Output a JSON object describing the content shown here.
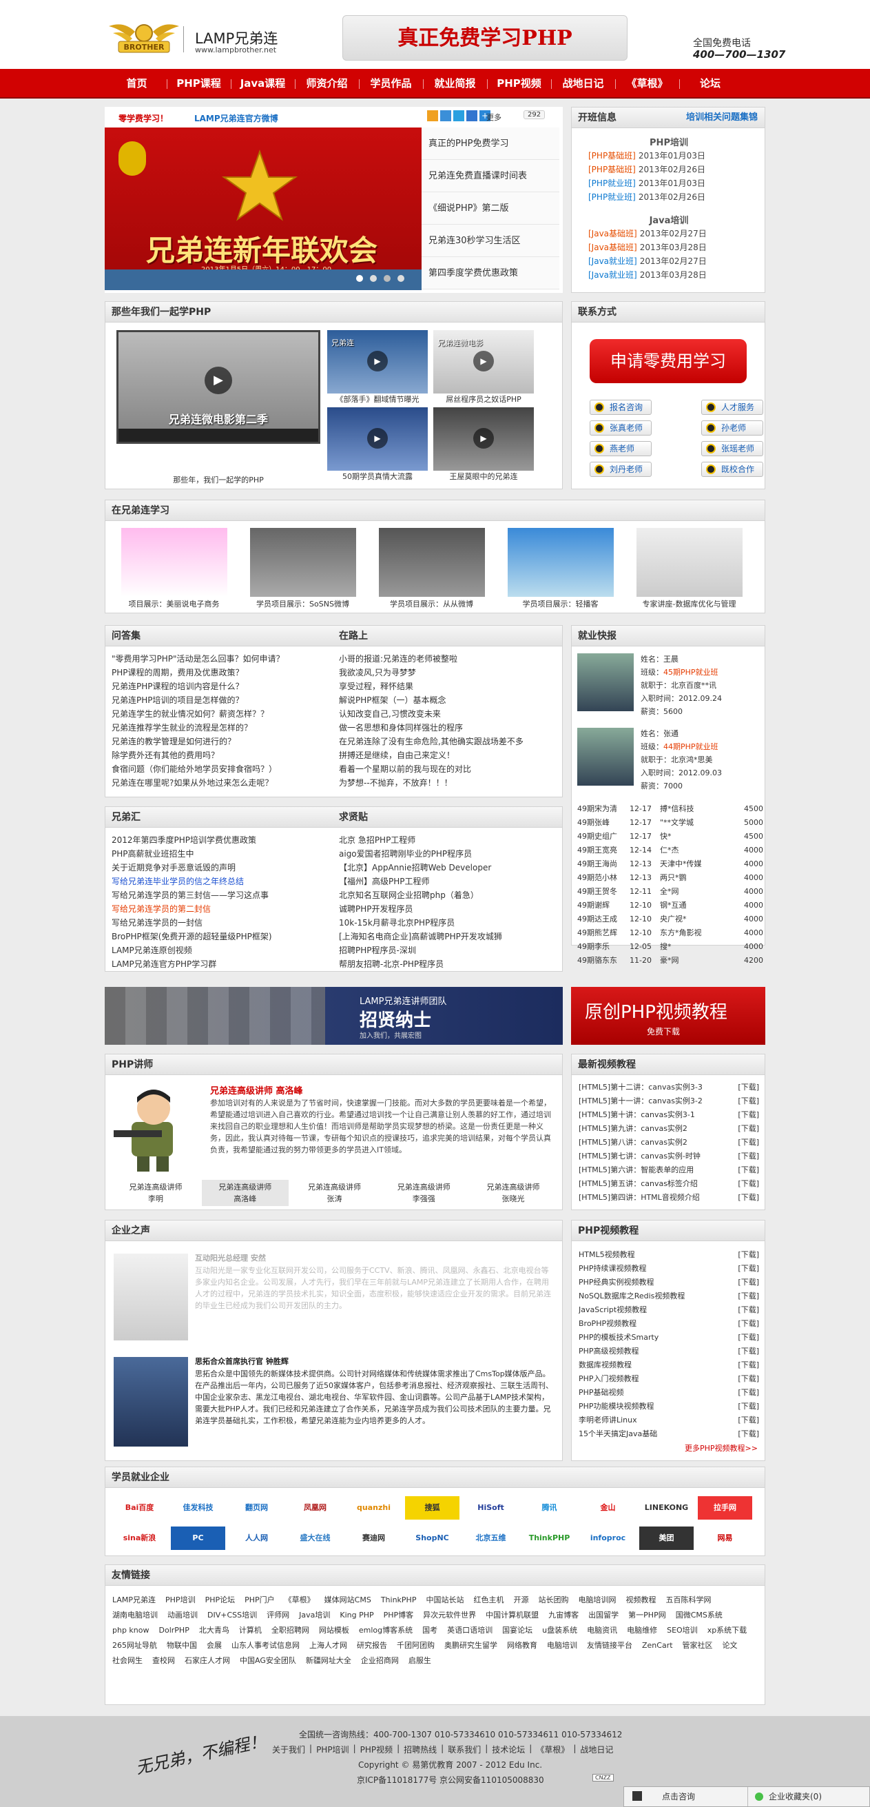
{
  "header": {
    "logo_text": "LAMP兄弟连",
    "logo_url": "www.lampbrother.net",
    "logo_mark": "BROTHER",
    "banner": "真正免费学习PHP",
    "phone_label": "全国免费电话",
    "phone_number": "400—700—1307"
  },
  "nav": [
    "首页",
    "PHP课程",
    "Java课程",
    "师资介绍",
    "学员作品",
    "就业简报",
    "PHP视频",
    "战地日记",
    "《草根》",
    "论坛"
  ],
  "news": {
    "left_link": "零学费学习！",
    "right_link": "LAMP兄弟连官方微博",
    "share_more": "更多",
    "share_count": "292",
    "slide_text": "兄弟连新年联欢会",
    "slide_sub": "2013年1月5日（周六）14：00—17：00",
    "items": [
      "真正的PHP免费学习",
      "兄弟连免费直播课时间表",
      "《细说PHP》第二版",
      "兄弟连30秒学习生活区",
      "第四季度学费优惠政策"
    ]
  },
  "open": {
    "title": "开班信息",
    "link": "培训相关问题集锦",
    "php_title": "PHP培训",
    "php_rows": [
      {
        "tag": "[PHP基础班]",
        "date": "2013年01月03日",
        "c": "red"
      },
      {
        "tag": "[PHP基础班]",
        "date": "2013年02月26日",
        "c": "red"
      },
      {
        "tag": "[PHP就业班]",
        "date": "2013年01月03日",
        "c": "blue"
      },
      {
        "tag": "[PHP就业班]",
        "date": "2013年02月26日",
        "c": "blue"
      }
    ],
    "java_title": "Java培训",
    "java_rows": [
      {
        "tag": "[Java基础班]",
        "date": "2013年02月27日",
        "c": "red"
      },
      {
        "tag": "[Java基础班]",
        "date": "2013年03月28日",
        "c": "red"
      },
      {
        "tag": "[Java就业班]",
        "date": "2013年02月27日",
        "c": "blue"
      },
      {
        "tag": "[Java就业班]",
        "date": "2013年03月28日",
        "c": "blue"
      }
    ]
  },
  "years": {
    "title": "那些年我们一起学PHP",
    "main_overlay": "兄弟连微电影第二季",
    "main_caption": "那些年，我们一起学的PHP",
    "thumbs": [
      {
        "caption": "《部落手》翻域情节曝光",
        "overlay": "兄弟连"
      },
      {
        "caption": "屌丝程序员之奴话PHP",
        "overlay": "兄弟连微电影"
      },
      {
        "caption": "50期学员真情大流露",
        "overlay": ""
      },
      {
        "caption": "王屋莫眼中的兄弟连",
        "overlay": ""
      }
    ]
  },
  "contact": {
    "title": "联系方式",
    "apply": "申请零费用学习",
    "people": [
      "报名咨询",
      "人才服务",
      "张真老师",
      "孙老师",
      "燕老师",
      "张瑶老师",
      "刘丹老师",
      "既校合作"
    ]
  },
  "study": {
    "title": "在兄弟连学习",
    "items": [
      "项目展示：美丽说电子商务",
      "学员项目展示：SoSNS微博",
      "学员项目展示：从从微博",
      "学员项目展示：轻播客",
      "专家讲座-数据库优化与管理"
    ]
  },
  "faq": {
    "title": "问答集",
    "items": [
      "\"零费用学习PHP\"活动是怎么回事？如何申请？",
      "PHP课程的周期，费用及优惠政策？",
      "兄弟连PHP课程的培训内容是什么？",
      "兄弟连PHP培训的项目是怎样做的？",
      "兄弟连学生的就业情况如何？薪资怎样？？",
      "兄弟连推荐学生就业的流程是怎样的？",
      "兄弟连的教学管理是如何进行的？",
      "除学费外还有其他的费用吗？",
      "食宿问题（你们能给外地学员安排食宿吗？）",
      "兄弟连在哪里呢?如果从外地过来怎么走呢？"
    ]
  },
  "road": {
    "title": "在路上",
    "items": [
      "小哥的报道:兄弟连的老师被整啦",
      "我欲凌风,只为寻梦梦",
      "享受过程，释怀结果",
      "解说PHP框架（一）基本概念",
      "认知改变自己,习惯改变未来",
      "做一名思想和身体同样强壮的程序",
      "在兄弟连除了没有生命危险,其他确实跟战场差不多",
      "拼搏还是继续，自由己来定义！",
      "看着一个星期以前的我与现在的对比",
      "为梦想--不抛弃，不放弃！！！"
    ]
  },
  "jobs": {
    "title": "就业快报",
    "profiles": [
      {
        "name": "姓名：王晨",
        "class_label": "班级：",
        "class_val": "45期PHP就业班",
        "company": "就职于：北京百度**讯",
        "date": "入职时间：2012.09.24",
        "salary": "薪资：5600"
      },
      {
        "name": "姓名：张通",
        "class_label": "班级：",
        "class_val": "44期PHP就业班",
        "company": "就职于：北京鸿*思美",
        "date": "入职时间：2012.09.03",
        "salary": "薪资：7000"
      }
    ],
    "rows": [
      [
        "49期宋为清",
        "12-17",
        "搏*信科技",
        "4500"
      ],
      [
        "49期张峰",
        "12-17",
        "\"**文学城",
        "5000"
      ],
      [
        "49期史组广",
        "12-17",
        "快*",
        "4500"
      ],
      [
        "49期王宽亮",
        "12-14",
        "仁*杰",
        "4000"
      ],
      [
        "49期王海尚",
        "12-13",
        "天津中*传媒",
        "4000"
      ],
      [
        "49期范小林",
        "12-13",
        "两只*鹦",
        "4000"
      ],
      [
        "49期王贺冬",
        "12-11",
        "全*网",
        "4000"
      ],
      [
        "49期谢辉",
        "12-10",
        "钢*互通",
        "4000"
      ],
      [
        "49期达王成",
        "12-10",
        "央广视*",
        "4000"
      ],
      [
        "49期熊艺辉",
        "12-10",
        "东方*角影视",
        "4000"
      ],
      [
        "49期李乐",
        "12-05",
        "搜*",
        "4000"
      ],
      [
        "49期骆东东",
        "11-20",
        "豪*网",
        "4200"
      ]
    ]
  },
  "brothers": {
    "title": "兄弟汇",
    "items": [
      {
        "t": "2012年第四季度PHP培训学费优惠政策",
        "c": "n"
      },
      {
        "t": "PHP高薪就业班招生中",
        "c": "n"
      },
      {
        "t": "关于近期竞争对手恶意诋毁的声明",
        "c": "n"
      },
      {
        "t": "写给兄弟连毕业学员的信之年终总结",
        "c": "b"
      },
      {
        "t": "写给兄弟连学员的第三封信——学习这点事",
        "c": "n"
      },
      {
        "t": "写给兄弟连学员的第二封信",
        "c": "r"
      },
      {
        "t": "写给兄弟连学员的一封信",
        "c": "n"
      },
      {
        "t": "BroPHP框架(免费开源的超轻量级PHP框架)",
        "c": "n"
      },
      {
        "t": "LAMP兄弟连原创视频",
        "c": "n"
      },
      {
        "t": "LAMP兄弟连官方PHP学习群",
        "c": "n"
      }
    ]
  },
  "hiring": {
    "title": "求贤贴",
    "items": [
      "北京 急招PHP工程师",
      "aigo爱国者招聘刚毕业的PHP程序员",
      "【北京】AppAnnie招聘Web Developer",
      "【福州】高级PHP工程师",
      "北京知名互联网企业招聘php（着急）",
      "诚聘PHP开发程序员",
      "10k-15k月薪寻北京PHP程序员",
      "[上海知名电商企业]高薪诚聘PHP开发攻城狮",
      "招聘PHP程序员-深圳",
      "帮朋友招聘-北京-PHP程序员"
    ]
  },
  "ad": {
    "left_small": "LAMP兄弟连讲师团队",
    "left_big": "招贤纳士",
    "left_sub": "加入我们，共展宏图",
    "right_big": "原创PHP视频教程",
    "right_sub": "免费下载"
  },
  "teachers": {
    "title": "PHP讲师",
    "name": "兄弟连高级讲师 高洛峰",
    "desc": "参加培训对有的人来说是为了节省时间，快速掌握一门技能。而对大多数的学员更要味着是一个希望，希望能通过培训进入自己喜欢的行业。希望通过培训找一个让自己满意让别人羡慕的好工作，通过培训来找回自己的职业理想和人生价值！而培训师是帮助学员实现梦想的桥梁。这是一份责任更是一种义务，因此，我认真对待每一节课，专研每个知识点的授课技巧，追求完美的培训结果，对每个学员认真负责，我希望能通过我的努力带领更多的学员进入IT领域。",
    "tabs": [
      {
        "a": "兄弟连高级讲师",
        "b": "李明"
      },
      {
        "a": "兄弟连高级讲师",
        "b": "高洛峰"
      },
      {
        "a": "兄弟连高级讲师",
        "b": "张涛"
      },
      {
        "a": "兄弟连高级讲师",
        "b": "李强强"
      },
      {
        "a": "兄弟连高级讲师",
        "b": "张晓光"
      }
    ]
  },
  "latest": {
    "title": "最新视频教程",
    "items": [
      "[HTML5]第十二讲：canvas实例3-3",
      "[HTML5]第十一讲：canvas实例3-2",
      "[HTML5]第十讲：canvas实例3-1",
      "[HTML5]第九讲：canvas实例2",
      "[HTML5]第八讲：canvas实例2",
      "[HTML5]第七讲：canvas实例-时钟",
      "[HTML5]第六讲：智能表单的应用",
      "[HTML5]第五讲：canvas标签介绍",
      "[HTML5]第四讲：HTML音视频介绍"
    ],
    "dl": "[下载]"
  },
  "companies": {
    "title": "企业之声",
    "p1_name": "互动阳光总经理 安然",
    "p1_text": "互动阳光是一家专业化互联网开发公司，公司服务于CCTV、新浪、腾讯、凤凰网、永鑫石、北京电视台等多家业内知名企业。公司发展，人才先行，我们早在三年前就与LAMP兄弟连建立了长期用人合作，在聘用人才的过程中，兄弟连的学员技术扎实，知识全面，态度积极，能够快速适应企业开发的需求。目前兄弟连的毕业生已经成为我们公司开发团队的主力。",
    "p2_name": "思拓合众首席执行官 钟胜辉",
    "p2_text": "思拓合众是中国领先的新媒体技术提供商。公司针对网络媒体和传统媒体需求推出了CmsTop媒体版产品。在产品推出后一年内，公司已服务了近50家媒体客户，包括参考消息报社、经济观察报社、三联生活周刊、中国企业家杂志、黑龙江电视台、湖北电视台、华军软件园、金山词霸等。公司产品基于LAMP技术架构，需要大批PHP人才。我们已经和兄弟连建立了合作关系，兄弟连学员成为我们公司技术团队的主要力量。兄弟连学员基础扎实，工作积极，希望兄弟连能为业内培养更多的人才。"
  },
  "videos": {
    "title": "PHP视频教程",
    "items": [
      "HTML5视频教程",
      "PHP持续课视频教程",
      "PHP经典实例视频教程",
      "NoSQL数据库之Redis视频教程",
      "JavaScript视频教程",
      "BroPHP视频教程",
      "PHP的模板技术Smarty",
      "PHP高级视频教程",
      "数据库视频教程",
      "PHP入门视频教程",
      "PHP基础视频",
      "PHP功能模块视频教程",
      "李明老师讲Linux",
      "15个半天搞定Java基础"
    ],
    "dl": "[下载]",
    "more": "更多PHP视频教程>>"
  },
  "employers": {
    "title": "学员就业企业",
    "logos": [
      {
        "t": "Bai百度",
        "c": "#d51e1e"
      },
      {
        "t": "佳发科技",
        "c": "#1a6fc4"
      },
      {
        "t": "翻页网",
        "c": "#1a6fc4"
      },
      {
        "t": "凤凰网",
        "c": "#b01d1d"
      },
      {
        "t": "quanzhi",
        "c": "#e08800"
      },
      {
        "t": "搜狐",
        "c": "#333",
        "bg": "#f5d300"
      },
      {
        "t": "HiSoft",
        "c": "#233e9a"
      },
      {
        "t": "腾讯",
        "c": "#1a8fd8"
      },
      {
        "t": "金山",
        "c": "#d11"
      },
      {
        "t": "LINEKONG",
        "c": "#333"
      },
      {
        "t": "拉手网",
        "c": "#fff",
        "bg": "#e33"
      },
      {
        "t": "sina新浪",
        "c": "#d51e1e"
      },
      {
        "t": "PC",
        "c": "#fff",
        "bg": "#1a5fb4"
      },
      {
        "t": "人人网",
        "c": "#1a5fb4"
      },
      {
        "t": "盛大在线",
        "c": "#2a7ac4"
      },
      {
        "t": "赛迪网",
        "c": "#333"
      },
      {
        "t": "ShopNC",
        "c": "#1a5fb4"
      },
      {
        "t": "北京五维",
        "c": "#1a6fc4"
      },
      {
        "t": "ThinkPHP",
        "c": "#2a9a2a"
      },
      {
        "t": "infoproc",
        "c": "#1a6fc4"
      },
      {
        "t": "美团",
        "c": "#fff",
        "bg": "#333"
      },
      {
        "t": "网易",
        "c": "#c00"
      }
    ]
  },
  "links": {
    "title": "友情链接",
    "items": [
      "LAMP兄弟连",
      "PHP培训",
      "PHP论坛",
      "PHP门户",
      "《草根》",
      "媒体网站CMS",
      "ThinkPHP",
      "中国站长站",
      "红色主机",
      "开源",
      "站长团购",
      "电脑培训网",
      "视频教程",
      "五百陈科学网",
      "湖南电脑培训",
      "动画培训",
      "DIV+CSS培训",
      "评师网",
      "Java培训",
      "King PHP",
      "PHP博客",
      "异次元软件世界",
      "中国计算机联盟",
      "九宙博客",
      "出国留学",
      "第一PHP网",
      "国微CMS系统",
      "php know",
      "DolrPHP",
      "北大青鸟",
      "计算机",
      "全职招聘网",
      "网站模板",
      "emlog博客系统",
      "国考",
      "英语口语培训",
      "国宴论坛",
      "u盘装系统",
      "电脑资讯",
      "电脑维修",
      "SEO培训",
      "xp系统下载",
      "265网址导航",
      "物联中国",
      "会展",
      "山东人事考试信息网",
      "上海人才网",
      "研究报告",
      "千团阿团购",
      "奥鹏研究生留学",
      "网络教育",
      "电脑培训",
      "友情链接平台",
      "ZenCart",
      "管家社区",
      "论文",
      "社会网生",
      "查校网",
      "石家庄人才网",
      "中国AG安全团队",
      "新疆网址大全",
      "企业招商网",
      "启服生"
    ]
  },
  "footer": {
    "slogan": "无兄弟，不编程！",
    "hotline": "全国统一咨询热线：400-700-1307    010-57334610    010-57334611    010-57334612",
    "links": [
      "关于我们",
      "PHP培训",
      "PHP视频",
      "招聘热线",
      "联系我们",
      "技术论坛",
      "《草根》",
      "战地日记"
    ],
    "copyright": "Copyright © 易第优教育 2007 - 2012 Edu Inc.",
    "icp": "京ICP备11018177号    京公网安备110105008830",
    "cnzz": "CNZZ"
  },
  "chat": {
    "consult": "点击咨询",
    "fav": "企业收藏夹(0)"
  }
}
